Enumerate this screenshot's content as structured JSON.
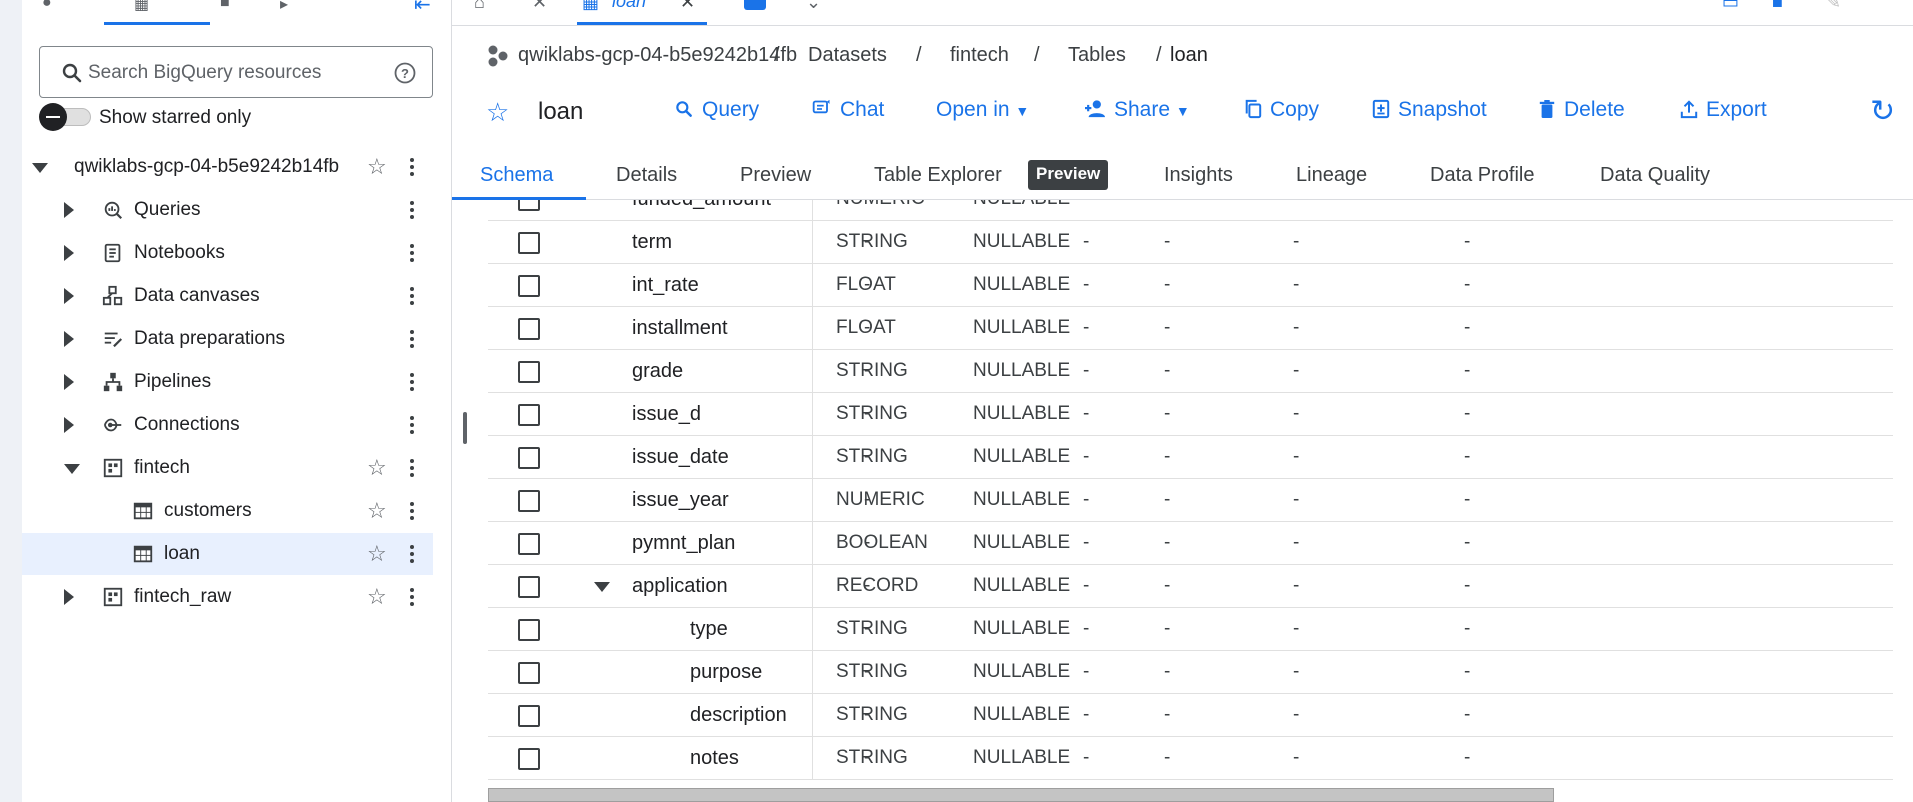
{
  "left_panel": {
    "search": {
      "placeholder": "Search BigQuery resources"
    },
    "starred_toggle_label": "Show starred only",
    "tree": [
      {
        "label": "qwiklabs-gcp-04-b5e9242b14fb",
        "level": 0,
        "expanded": true,
        "icon": "none",
        "starred": false
      },
      {
        "label": "Queries",
        "level": 1,
        "expanded": false,
        "icon": "queries-icon"
      },
      {
        "label": "Notebooks",
        "level": 1,
        "expanded": false,
        "icon": "notebook-icon"
      },
      {
        "label": "Data canvases",
        "level": 1,
        "expanded": false,
        "icon": "canvas-icon"
      },
      {
        "label": "Data preparations",
        "level": 1,
        "expanded": false,
        "icon": "data-prep-icon"
      },
      {
        "label": "Pipelines",
        "level": 1,
        "expanded": false,
        "icon": "pipeline-icon"
      },
      {
        "label": "Connections",
        "level": 1,
        "expanded": false,
        "icon": "connection-icon"
      },
      {
        "label": "fintech",
        "level": 1,
        "expanded": true,
        "icon": "dataset-icon",
        "starred": false
      },
      {
        "label": "customers",
        "level": 2,
        "icon": "table-icon",
        "starred": false
      },
      {
        "label": "loan",
        "level": 2,
        "icon": "table-icon",
        "starred": false,
        "selected": true
      },
      {
        "label": "fintech_raw",
        "level": 1,
        "expanded": false,
        "icon": "dataset-icon",
        "starred": false
      }
    ]
  },
  "editor_tabs": {
    "active_title": "loan"
  },
  "breadcrumb": {
    "project": "qwiklabs-gcp-04-b5e9242b14fb",
    "sep1": "/",
    "datasets": "Datasets",
    "sep2": "/",
    "dataset": "fintech",
    "sep3": "/",
    "tables": "Tables",
    "sep4": "/",
    "current": "loan"
  },
  "toolbar": {
    "title": "loan",
    "query": "Query",
    "chat": "Chat",
    "open_in": "Open in",
    "share": "Share",
    "copy": "Copy",
    "snapshot": "Snapshot",
    "delete": "Delete",
    "export": "Export"
  },
  "subtabs": {
    "schema": "Schema",
    "details": "Details",
    "preview": "Preview",
    "table_explorer": "Table Explorer",
    "table_explorer_badge": "Preview",
    "insights": "Insights",
    "lineage": "Lineage",
    "data_profile": "Data Profile",
    "data_quality": "Data Quality"
  },
  "schema_rows": [
    {
      "name": "funded_amount",
      "type": "NUMERIC",
      "mode": "NULLABLE",
      "nested": false,
      "partial": true
    },
    {
      "name": "term",
      "type": "STRING",
      "mode": "NULLABLE",
      "nested": false
    },
    {
      "name": "int_rate",
      "type": "FLOAT",
      "mode": "NULLABLE",
      "nested": false
    },
    {
      "name": "installment",
      "type": "FLOAT",
      "mode": "NULLABLE",
      "nested": false
    },
    {
      "name": "grade",
      "type": "STRING",
      "mode": "NULLABLE",
      "nested": false
    },
    {
      "name": "issue_d",
      "type": "STRING",
      "mode": "NULLABLE",
      "nested": false
    },
    {
      "name": "issue_date",
      "type": "STRING",
      "mode": "NULLABLE",
      "nested": false
    },
    {
      "name": "issue_year",
      "type": "NUMERIC",
      "mode": "NULLABLE",
      "nested": false
    },
    {
      "name": "pymnt_plan",
      "type": "BOOLEAN",
      "mode": "NULLABLE",
      "nested": false
    },
    {
      "name": "application",
      "type": "RECORD",
      "mode": "NULLABLE",
      "nested": false,
      "expandable": true
    },
    {
      "name": "type",
      "type": "STRING",
      "mode": "NULLABLE",
      "nested": true
    },
    {
      "name": "purpose",
      "type": "STRING",
      "mode": "NULLABLE",
      "nested": true
    },
    {
      "name": "description",
      "type": "STRING",
      "mode": "NULLABLE",
      "nested": true
    },
    {
      "name": "notes",
      "type": "STRING",
      "mode": "NULLABLE",
      "nested": true
    }
  ],
  "empty_cell": "-",
  "colors": {
    "accent": "#1a73e8",
    "selected_bg": "#e8f0fe",
    "badge_bg": "#3c4043"
  }
}
